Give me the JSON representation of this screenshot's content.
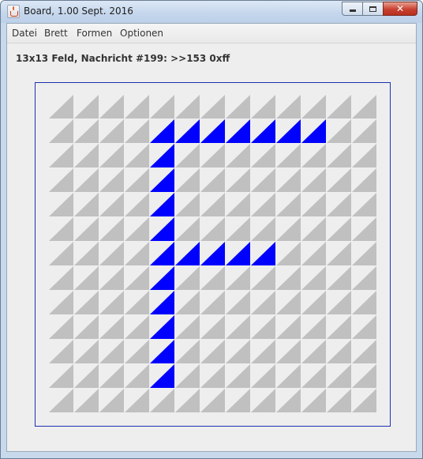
{
  "window": {
    "title": "Board, 1.00 Sept. 2016",
    "controls": {
      "minimize_icon": "minimize-icon",
      "maximize_icon": "maximize-icon",
      "close_label": "✕"
    }
  },
  "menu": {
    "items": [
      {
        "label": "Datei"
      },
      {
        "label": "Brett"
      },
      {
        "label": "Formen"
      },
      {
        "label": "Optionen"
      }
    ]
  },
  "status": {
    "message": "13x13 Feld, Nachricht #199: >>153 0xff"
  },
  "board": {
    "rows": 13,
    "cols": 13,
    "cell_shape": "triangle",
    "colors": {
      "inactive": "#c0c0c0",
      "active": "#0000ff"
    },
    "active_cells": [
      [
        1,
        4
      ],
      [
        1,
        5
      ],
      [
        1,
        6
      ],
      [
        1,
        7
      ],
      [
        1,
        8
      ],
      [
        1,
        9
      ],
      [
        1,
        10
      ],
      [
        2,
        4
      ],
      [
        3,
        4
      ],
      [
        4,
        4
      ],
      [
        5,
        4
      ],
      [
        6,
        4
      ],
      [
        6,
        5
      ],
      [
        6,
        6
      ],
      [
        6,
        7
      ],
      [
        6,
        8
      ],
      [
        7,
        4
      ],
      [
        8,
        4
      ],
      [
        9,
        4
      ],
      [
        10,
        4
      ],
      [
        11,
        4
      ]
    ]
  }
}
